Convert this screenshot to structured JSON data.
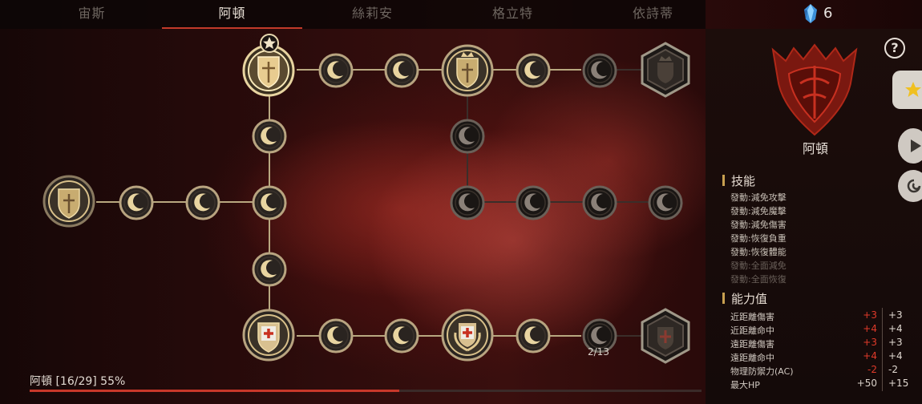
{
  "tabs": [
    {
      "label": "宙斯",
      "active": false
    },
    {
      "label": "阿頓",
      "active": true
    },
    {
      "label": "絲莉安",
      "active": false
    },
    {
      "label": "格立特",
      "active": false
    },
    {
      "label": "依詩蒂",
      "active": false
    }
  ],
  "currency": {
    "icon": "blue-crystal-icon",
    "count": "6"
  },
  "panel": {
    "deity_name": "阿頓",
    "skills_title": "技能",
    "skills": [
      {
        "label": "發動:減免攻擊",
        "unlocked": true
      },
      {
        "label": "發動:減免魔擊",
        "unlocked": true
      },
      {
        "label": "發動:減免傷害",
        "unlocked": true
      },
      {
        "label": "發動:恢復負重",
        "unlocked": true
      },
      {
        "label": "發動:恢復體能",
        "unlocked": true
      },
      {
        "label": "發動:全面減免",
        "unlocked": false
      },
      {
        "label": "發動:全面恢復",
        "unlocked": false
      }
    ],
    "stats_title": "能力值",
    "stats": [
      {
        "label": "近距離傷害",
        "bonus": "+3",
        "total": "+3"
      },
      {
        "label": "近距離命中",
        "bonus": "+4",
        "total": "+4"
      },
      {
        "label": "遠距離傷害",
        "bonus": "+3",
        "total": "+3"
      },
      {
        "label": "遠距離命中",
        "bonus": "+4",
        "total": "+4"
      },
      {
        "label": "物理防禦力(AC)",
        "bonus": "-2",
        "total": "-2"
      },
      {
        "label": "最大HP",
        "bonus": "+50",
        "total": "+15"
      }
    ]
  },
  "tree": {
    "counter": "2/13"
  },
  "progress": {
    "label": "阿頓 [16/29] 55%",
    "fraction": 0.55
  },
  "colors": {
    "accent_red": "#c8382a",
    "gold": "#c8b078",
    "stat_bonus_red": "#e03a2a"
  }
}
